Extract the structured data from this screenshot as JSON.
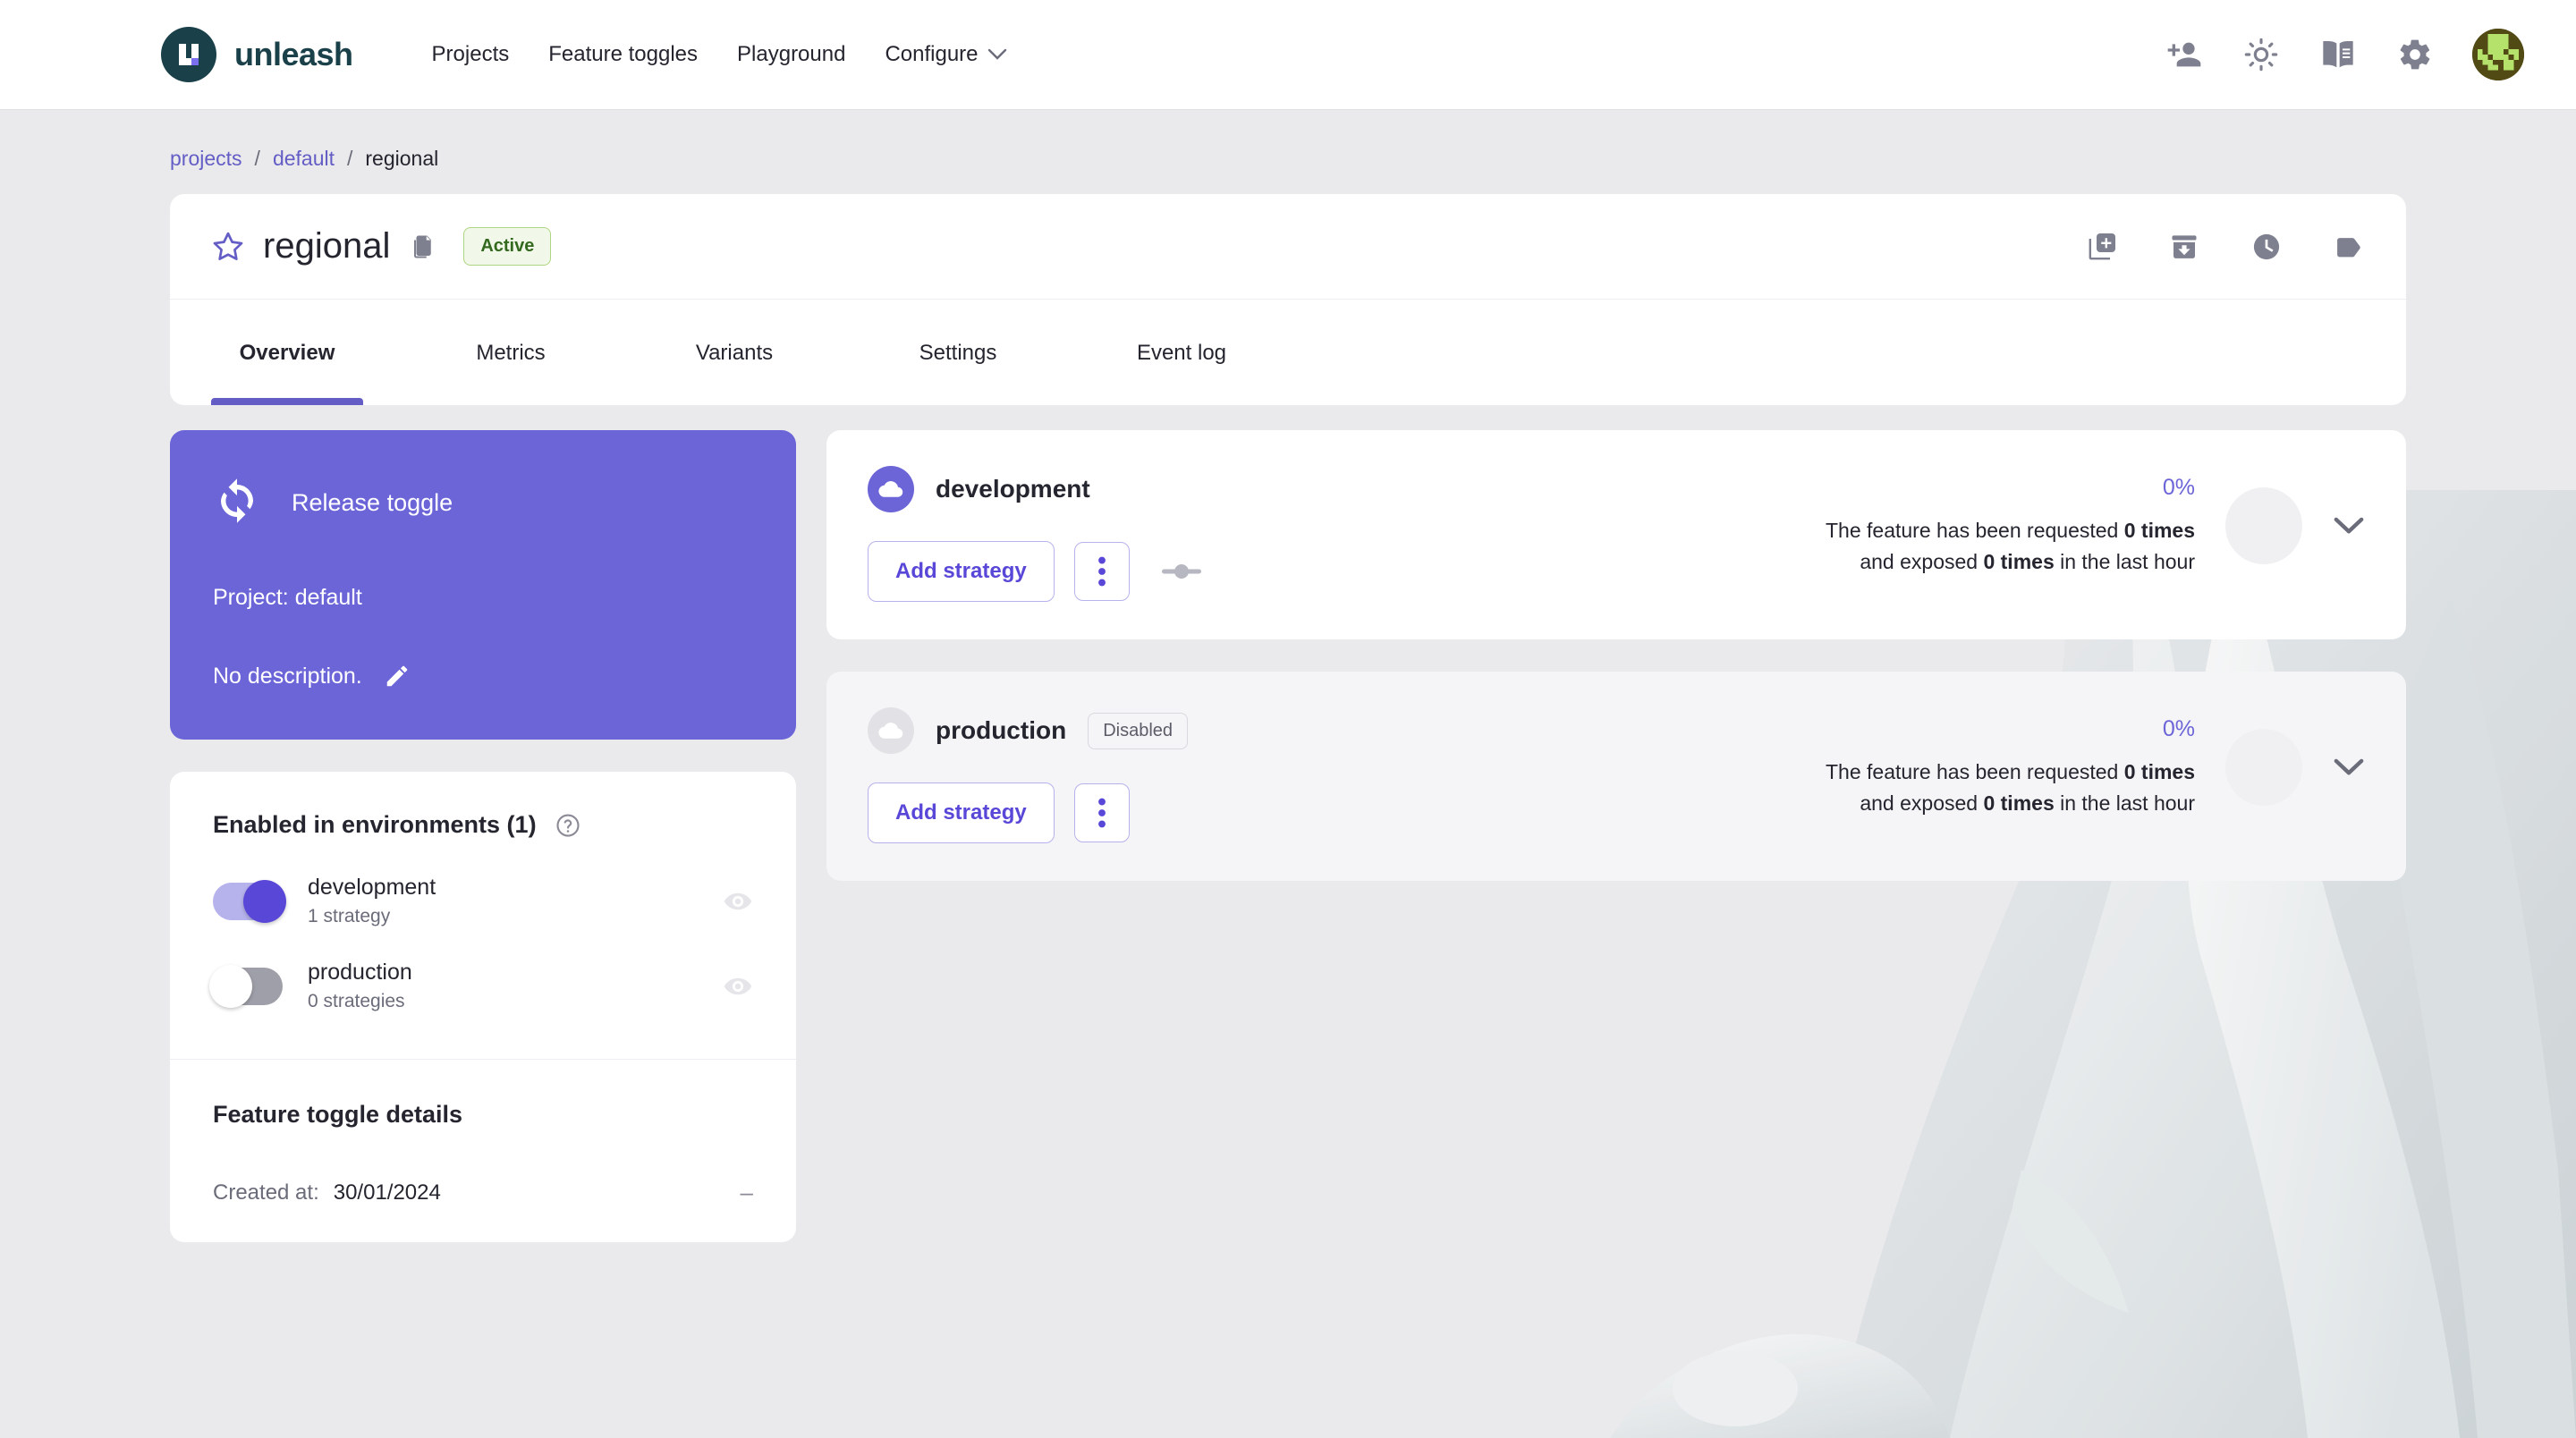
{
  "brand": {
    "name": "unleash",
    "logo_icon": "unleash-logo-icon",
    "accent": "#635DC5",
    "logo_bg": "#1A4049"
  },
  "navbar": {
    "links": [
      {
        "label": "Projects",
        "icon": null
      },
      {
        "label": "Feature toggles",
        "icon": null
      },
      {
        "label": "Playground",
        "icon": null
      },
      {
        "label": "Configure",
        "icon": "chevron-down-icon"
      }
    ],
    "actions": [
      {
        "name": "invite-user-icon",
        "label": "Invite user"
      },
      {
        "name": "light-mode-icon",
        "label": "Toggle theme"
      },
      {
        "name": "documentation-icon",
        "label": "Documentation"
      },
      {
        "name": "settings-gear-icon",
        "label": "Settings"
      }
    ],
    "avatar": {
      "name": "user-avatar",
      "bg": "#514a15",
      "fg": "#b5e26a"
    }
  },
  "breadcrumb": [
    {
      "label": "projects",
      "link": true
    },
    {
      "label": "default",
      "link": true
    },
    {
      "label": "regional",
      "link": false
    }
  ],
  "breadcrumb_separator": "/",
  "feature": {
    "name": "regional",
    "favorite_icon": "star-outline-icon",
    "copy_icon": "copy-icon",
    "status_badge": "Active",
    "status_colors": {
      "bg": "#f2f8e9",
      "border": "#aed581",
      "text": "#33691e"
    }
  },
  "header_actions": [
    {
      "name": "add-to-project-icon",
      "label": "Copy feature toggle"
    },
    {
      "name": "archive-icon",
      "label": "Archive feature toggle"
    },
    {
      "name": "history-icon",
      "label": "History"
    },
    {
      "name": "tag-icon",
      "label": "Tags"
    }
  ],
  "tabs": [
    {
      "label": "Overview",
      "active": true
    },
    {
      "label": "Metrics",
      "active": false
    },
    {
      "label": "Variants",
      "active": false
    },
    {
      "label": "Settings",
      "active": false
    },
    {
      "label": "Event log",
      "active": false
    }
  ],
  "release_card": {
    "icon": "sync-toggle-icon",
    "type_label": "Release toggle",
    "project_line": "Project: default",
    "description": "No description.",
    "edit_icon": "pencil-edit-icon",
    "bg": "#6C65D8"
  },
  "environments_card": {
    "title": "Enabled in environments (1)",
    "help_icon": "help-circle-icon",
    "rows": [
      {
        "name": "development",
        "sub": "1 strategy",
        "enabled": true,
        "visibility_icon": "eye-icon"
      },
      {
        "name": "production",
        "sub": "0 strategies",
        "enabled": false,
        "visibility_icon": "eye-icon"
      }
    ]
  },
  "details_card": {
    "title": "Feature toggle details",
    "created_label": "Created at:",
    "created_value": "30/01/2024",
    "collapse_glyph": "–"
  },
  "env_panels": [
    {
      "name": "development",
      "enabled": true,
      "status_badge": null,
      "cloud_icon": "cloud-icon",
      "add_strategy_label": "Add strategy",
      "kebab_icon": "more-vertical-icon",
      "strategy_node_icon": "strategy-node-icon",
      "percent": "0%",
      "metrics_line_1_prefix": "The feature has been requested ",
      "metrics_line_1_bold": "0 times",
      "metrics_line_2_prefix": "and exposed ",
      "metrics_line_2_bold": "0 times",
      "metrics_line_2_suffix": " in the last hour",
      "chart_icon": "donut-chart",
      "expand_icon": "chevron-down-icon"
    },
    {
      "name": "production",
      "enabled": false,
      "status_badge": "Disabled",
      "cloud_icon": "cloud-icon",
      "add_strategy_label": "Add strategy",
      "kebab_icon": "more-vertical-icon",
      "strategy_node_icon": null,
      "percent": "0%",
      "metrics_line_1_prefix": "The feature has been requested ",
      "metrics_line_1_bold": "0 times",
      "metrics_line_2_prefix": "and exposed ",
      "metrics_line_2_bold": "0 times",
      "metrics_line_2_suffix": " in the last hour",
      "chart_icon": "donut-chart",
      "expand_icon": "chevron-down-icon"
    }
  ]
}
